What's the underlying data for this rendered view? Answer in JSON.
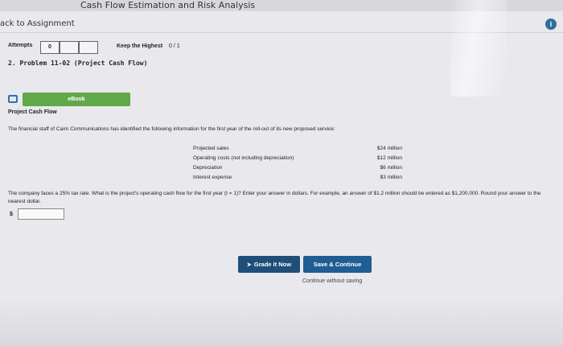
{
  "header": {
    "chapter_title": "Cash Flow Estimation and Risk Analysis",
    "back_link": "ack to Assignment",
    "info_icon": "info-icon"
  },
  "attempts": {
    "label": "Attempts",
    "value": "0",
    "keep_label": "Keep the Highest",
    "keep_score": "0 / 1"
  },
  "problem": {
    "title": "2. Problem 11-02 (Project Cash Flow)",
    "ebook_label": "eBook",
    "section_title": "Project Cash Flow",
    "intro": "The financial staff of Cairn Communications has identified the following information for the first year of the roll-out of its new proposed service:",
    "rows": [
      {
        "label": "Projected sales",
        "value": "$24 million"
      },
      {
        "label": "Operating costs (not including depreciation)",
        "value": "$12 million"
      },
      {
        "label": "Depreciation",
        "value": "$6 million"
      },
      {
        "label": "Interest expense",
        "value": "$3 million"
      }
    ],
    "question": "The company faces a 25% tax rate. What is the project's operating cash flow for the first year (t = 1)? Enter your answer in dollars. For example, an answer of $1.2 million should be entered as $1,200,000. Round your answer to the nearest dollar.",
    "currency": "$",
    "answer_value": ""
  },
  "actions": {
    "grade_label": "Grade it Now",
    "save_label": "Save & Continue",
    "continue_label": "Continue without saving"
  }
}
